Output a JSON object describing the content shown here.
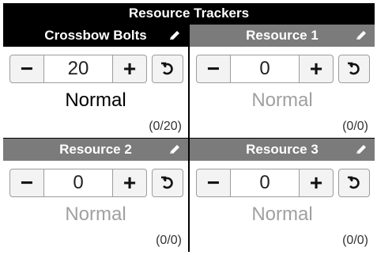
{
  "title": "Resource Trackers",
  "trackers": [
    {
      "name": "Crossbow Bolts",
      "value": "20",
      "status": "Normal",
      "count": "(0/20)"
    },
    {
      "name": "Resource 1",
      "value": "0",
      "status": "Normal",
      "count": "(0/0)"
    },
    {
      "name": "Resource 2",
      "value": "0",
      "status": "Normal",
      "count": "(0/0)"
    },
    {
      "name": "Resource 3",
      "value": "0",
      "status": "Normal",
      "count": "(0/0)"
    }
  ],
  "controls": {
    "minus": "−",
    "plus": "+"
  },
  "icons": {
    "edit": "pencil-icon",
    "reset": "undo-icon"
  }
}
